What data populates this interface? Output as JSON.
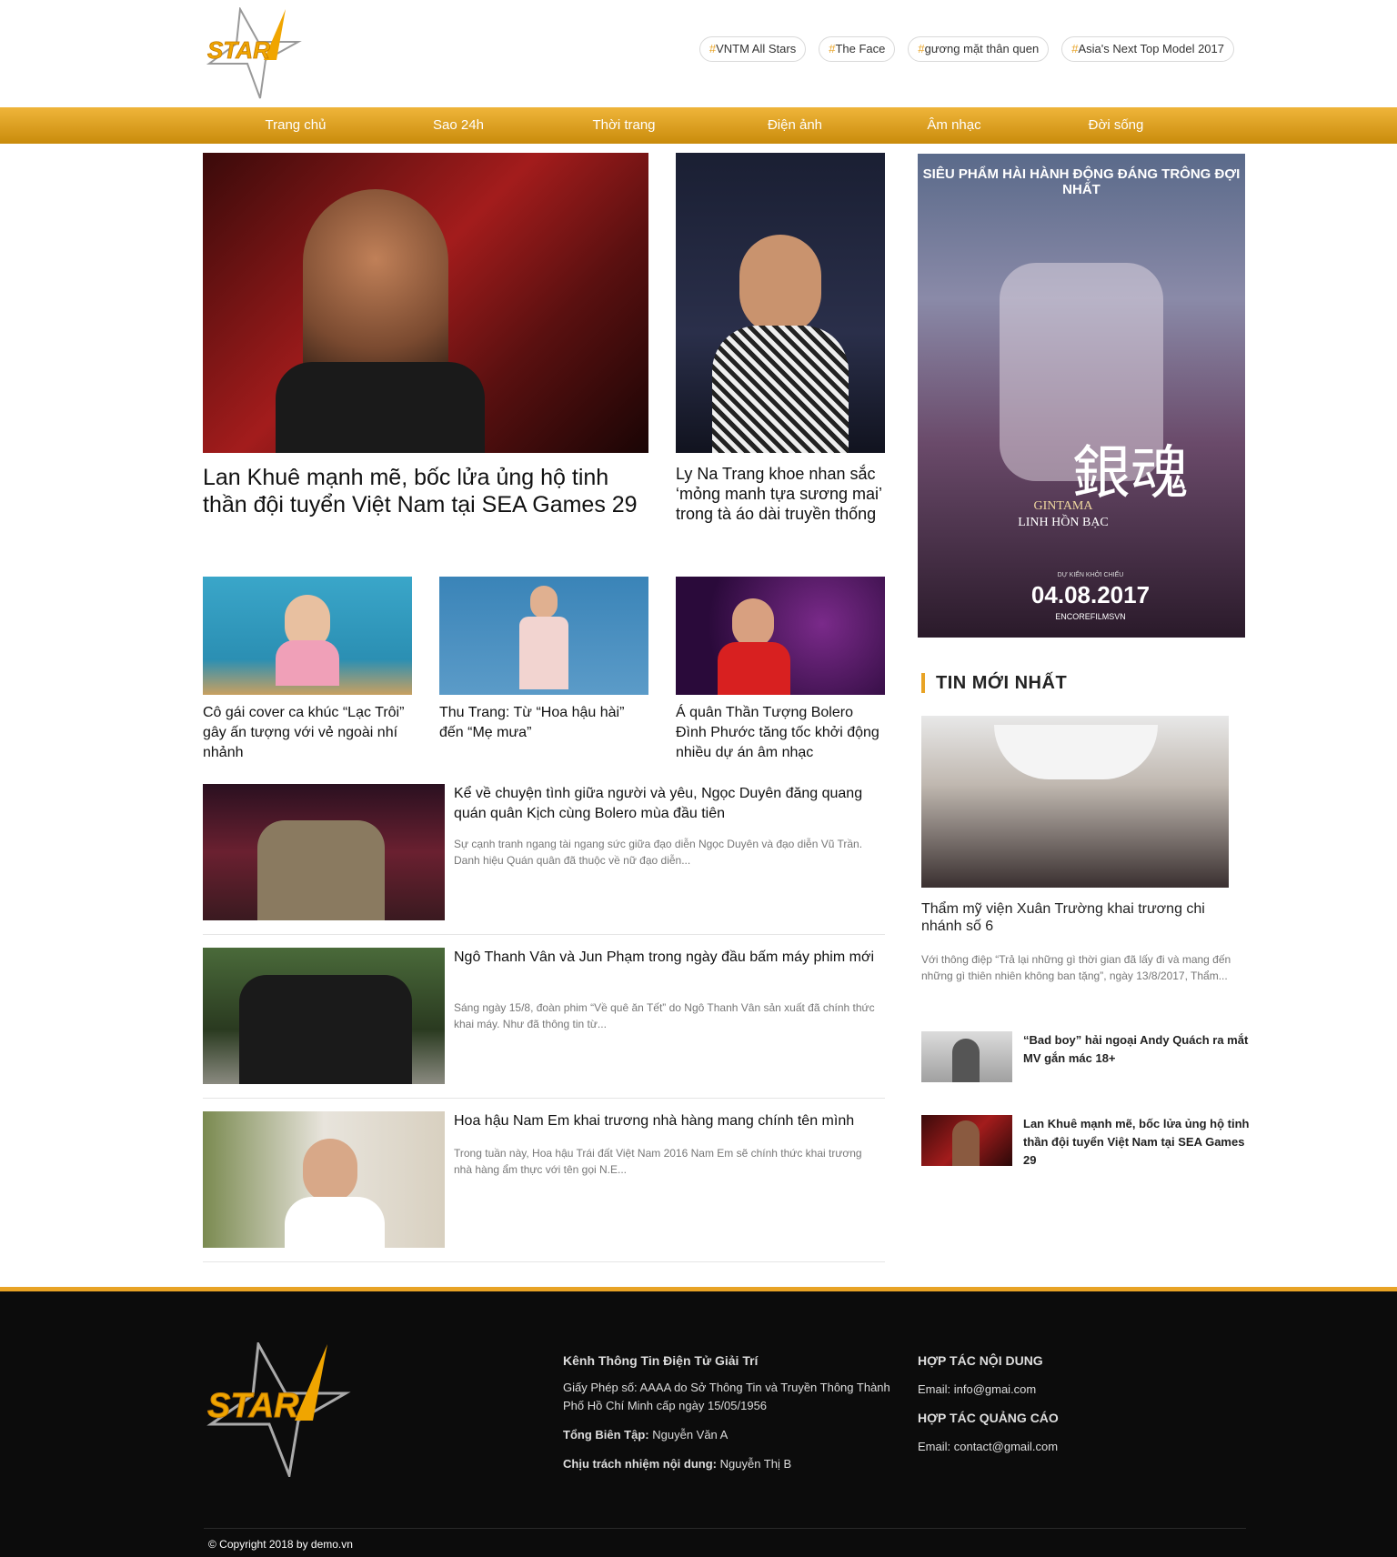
{
  "brand": {
    "logo_text": "STAR",
    "logo_number": "1"
  },
  "tags": [
    "VNTM All Stars",
    "The Face",
    "gương mặt thân quen",
    "Asia's Next Top Model 2017"
  ],
  "nav": [
    "Trang chủ",
    "Sao 24h",
    "Thời trang",
    "Điện ảnh",
    "Âm nhạc",
    "Đời sống"
  ],
  "featured": [
    {
      "title": "Lan Khuê mạnh mẽ, bốc lửa ủng hộ tinh thần đội tuyển Việt Nam tại SEA Games 29"
    },
    {
      "title": "Ly Na Trang khoe nhan sắc ‘mỏng manh tựa sương mai’ trong tà áo dài truyền thống"
    }
  ],
  "grid": [
    {
      "title": "Cô gái cover ca khúc “Lạc Trôi” gây ấn tượng với vẻ ngoài nhí nhảnh"
    },
    {
      "title": "Thu Trang: Từ “Hoa hậu hài” đến “Mẹ mưa”"
    },
    {
      "title": "Á quân Thần Tượng Bolero Đình Phước tăng tốc khởi động nhiều dự án âm nhạc"
    }
  ],
  "list": [
    {
      "title": "Kể về chuyện tình giữa người và yêu, Ngọc Duyên đăng quang quán quân Kịch cùng Bolero mùa đầu tiên",
      "excerpt": "Sự cạnh tranh ngang tài ngang sức giữa đạo diễn Ngọc Duyên và đạo diễn Vũ Trần. Danh hiệu Quán quân đã thuộc về nữ đạo diễn..."
    },
    {
      "title": "Ngô Thanh Vân và Jun Phạm trong ngày đầu bấm máy phim mới",
      "excerpt": "Sáng ngày 15/8, đoàn phim “Về quê ăn Tết” do Ngô Thanh Vân sản xuất đã chính thức khai máy. Như đã thông tin từ..."
    },
    {
      "title": "Hoa hậu Nam Em khai trương nhà hàng mang chính tên mình",
      "excerpt": "Trong tuần này, Hoa hậu Trái đất Việt Nam 2016 Nam Em sẽ chính thức khai trương nhà hàng ẩm thực với tên gọi N.E..."
    }
  ],
  "ad": {
    "headline": "SIÊU PHẨM HÀI HÀNH ĐỘNG ĐÁNG TRÔNG ĐỢI NHẤT",
    "name_en": "GINTAMA",
    "name_vi": "LINH HỒN BẠC",
    "kanji": "銀魂",
    "release_label": "DỰ KIẾN KHỞI CHIẾU",
    "date": "04.08.2017",
    "social": "ENCOREFILMSVN"
  },
  "sidebar": {
    "heading": "TIN MỚI NHẤT",
    "top": {
      "title": "Thẩm mỹ viện Xuân Trường khai trương chi nhánh số 6",
      "excerpt": "Với thông điệp “Trả lại những gì thời gian đã lấy đi và mang đến những gì thiên nhiên không ban tặng”, ngày 13/8/2017, Thẩm..."
    },
    "items": [
      {
        "title": "“Bad boy” hải ngoại Andy Quách ra mắt MV gắn mác 18+"
      },
      {
        "title": "Lan Khuê mạnh mẽ, bốc lửa ủng hộ tinh thần đội tuyển Việt Nam tại SEA Games 29"
      }
    ]
  },
  "footer": {
    "channel": "Kênh Thông Tin Điện Tử Giải Trí",
    "license": "Giấy Phép số: AAAA do Sở Thông Tin và Truyền Thông Thành Phố Hồ Chí Minh cấp ngày 15/05/1956",
    "editor_label": "Tổng Biên Tập:",
    "editor": "Nguyễn Văn A",
    "resp_label": "Chịu trách nhiệm nội dung:",
    "resp": "Nguyễn Thị B",
    "content_head": "HỢP TÁC NỘI DUNG",
    "content_email": "Email: info@gmai.com",
    "ads_head": "HỢP TÁC QUẢNG CÁO",
    "ads_email": "Email: contact@gmail.com",
    "copyright": "© Copyright 2018 by demo.vn"
  }
}
